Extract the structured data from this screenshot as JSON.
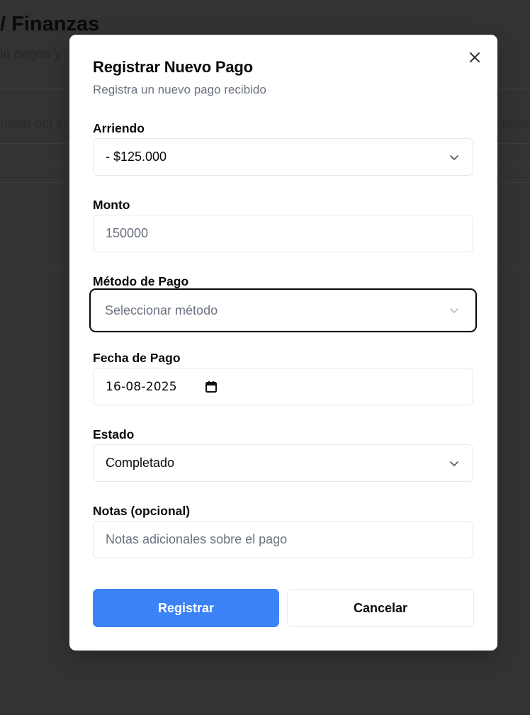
{
  "background": {
    "title": "/ Finanzas",
    "subtitle": "le pagos y",
    "search_text": "uscar por cl",
    "state_text": "estad"
  },
  "modal": {
    "title": "Registrar Nuevo Pago",
    "description": "Registra un nuevo pago recibido",
    "fields": {
      "arriendo": {
        "label": "Arriendo",
        "value": "- $125.000"
      },
      "monto": {
        "label": "Monto",
        "placeholder": "150000"
      },
      "metodo": {
        "label": "Método de Pago",
        "placeholder": "Seleccionar método"
      },
      "fecha": {
        "label": "Fecha de Pago",
        "value": "16-08-2025"
      },
      "estado": {
        "label": "Estado",
        "value": "Completado"
      },
      "notas": {
        "label": "Notas (opcional)",
        "placeholder": "Notas adicionales sobre el pago"
      }
    },
    "buttons": {
      "submit": "Registrar",
      "cancel": "Cancelar"
    }
  },
  "colors": {
    "primary": "#3b82f6",
    "overlay": "#333333",
    "muted_text": "#6b7280"
  },
  "icons": [
    "close-icon",
    "chevron-down-icon",
    "calendar-icon"
  ]
}
